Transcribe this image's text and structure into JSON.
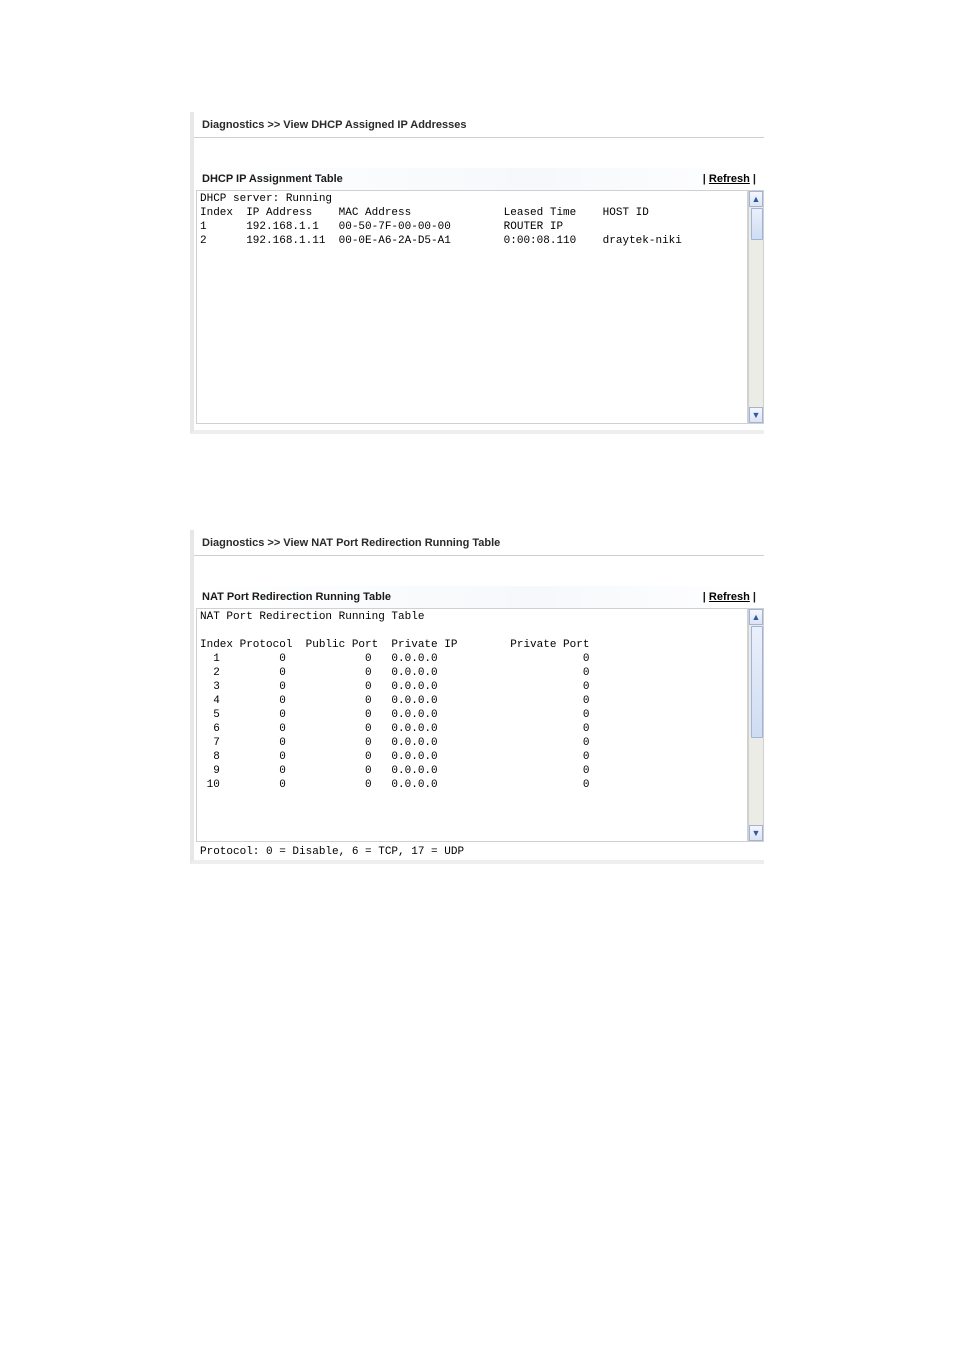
{
  "panel1": {
    "breadcrumb": "Diagnostics >> View DHCP Assigned IP Addresses",
    "title": "DHCP IP Assignment Table",
    "refresh": "Refresh",
    "server_status_line": "DHCP server: Running",
    "headers": {
      "index": "Index",
      "ip": "IP Address",
      "mac": "MAC Address",
      "leased": "Leased Time",
      "host": "HOST ID"
    },
    "rows": [
      {
        "index": "1",
        "ip": "192.168.1.1",
        "mac": "00-50-7F-00-00-00",
        "leased": "ROUTER IP",
        "host": ""
      },
      {
        "index": "2",
        "ip": "192.168.1.11",
        "mac": "00-0E-A6-2A-D5-A1",
        "leased": "0:00:08.110",
        "host": "draytek-niki"
      }
    ]
  },
  "panel2": {
    "breadcrumb": "Diagnostics >> View NAT Port Redirection Running Table",
    "title": "NAT Port Redirection Running Table",
    "refresh": "Refresh",
    "caption": "NAT Port Redirection Running Table",
    "headers": {
      "index": "Index",
      "protocol": "Protocol",
      "pubport": "Public Port",
      "privip": "Private IP",
      "privport": "Private Port"
    },
    "rows": [
      {
        "index": "1",
        "protocol": "0",
        "pubport": "0",
        "privip": "0.0.0.0",
        "privport": "0"
      },
      {
        "index": "2",
        "protocol": "0",
        "pubport": "0",
        "privip": "0.0.0.0",
        "privport": "0"
      },
      {
        "index": "3",
        "protocol": "0",
        "pubport": "0",
        "privip": "0.0.0.0",
        "privport": "0"
      },
      {
        "index": "4",
        "protocol": "0",
        "pubport": "0",
        "privip": "0.0.0.0",
        "privport": "0"
      },
      {
        "index": "5",
        "protocol": "0",
        "pubport": "0",
        "privip": "0.0.0.0",
        "privport": "0"
      },
      {
        "index": "6",
        "protocol": "0",
        "pubport": "0",
        "privip": "0.0.0.0",
        "privport": "0"
      },
      {
        "index": "7",
        "protocol": "0",
        "pubport": "0",
        "privip": "0.0.0.0",
        "privport": "0"
      },
      {
        "index": "8",
        "protocol": "0",
        "pubport": "0",
        "privip": "0.0.0.0",
        "privport": "0"
      },
      {
        "index": "9",
        "protocol": "0",
        "pubport": "0",
        "privip": "0.0.0.0",
        "privport": "0"
      },
      {
        "index": "10",
        "protocol": "0",
        "pubport": "0",
        "privip": "0.0.0.0",
        "privport": "0"
      }
    ],
    "footnote": "Protocol: 0 = Disable, 6 = TCP, 17 = UDP"
  }
}
